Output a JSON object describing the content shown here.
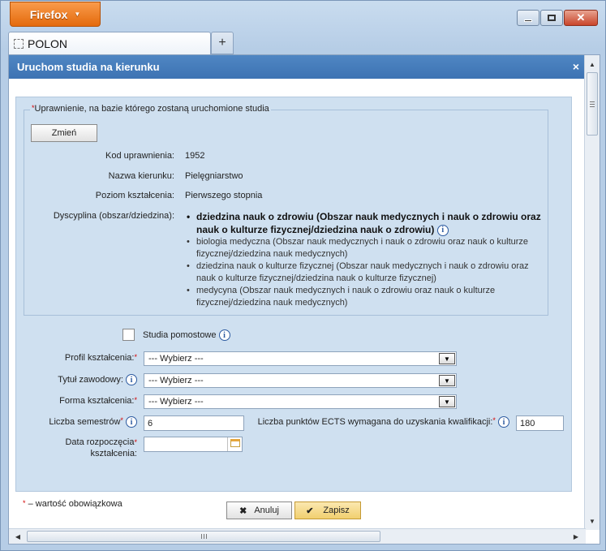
{
  "browser": {
    "app_name": "Firefox",
    "tab_title": "POLON",
    "new_tab_label": "+"
  },
  "dialog": {
    "title": "Uruchom studia na kierunku",
    "close_label": "×"
  },
  "permission": {
    "legend": "Uprawnienie, na bazie którego zostaną uruchomione studia",
    "change_button": "Zmień",
    "rows": [
      {
        "label": "Kod uprawnienia:",
        "value": "1952"
      },
      {
        "label": "Nazwa kierunku:",
        "value": "Pielęgniarstwo"
      },
      {
        "label": "Poziom kształcenia:",
        "value": "Pierwszego stopnia"
      }
    ],
    "discipline_label": "Dyscyplina (obszar/dziedzina):",
    "disciplines": [
      "dziedzina nauk o zdrowiu (Obszar nauk medycznych i nauk o zdrowiu oraz nauk o kulturze fizycznej/dziedzina nauk o zdrowiu)",
      "biologia medyczna (Obszar nauk medycznych i nauk o zdrowiu oraz nauk o kulturze fizycznej/dziedzina nauk medycznych)",
      "dziedzina nauk o kulturze fizycznej (Obszar nauk medycznych i nauk o zdrowiu oraz nauk o kulturze fizycznej/dziedzina nauk o kulturze fizycznej)",
      "medycyna (Obszar nauk medycznych i nauk o zdrowiu oraz nauk o kulturze fizycznej/dziedzina nauk medycznych)"
    ]
  },
  "form": {
    "bridging_label": "Studia pomostowe",
    "bridging_checked": false,
    "profile_label": "Profil kształcenia:",
    "profile_value": "--- Wybierz ---",
    "title_label": "Tytuł zawodowy:",
    "title_value": "--- Wybierz ---",
    "form_label": "Forma kształcenia:",
    "form_value": "--- Wybierz ---",
    "semesters_label": "Liczba semestrów",
    "semesters_value": "6",
    "ects_label": "Liczba punktów ECTS wymagana do uzyskania kwalifikacji:",
    "ects_value": "180",
    "start_date_label_1": "Data rozpoczęcia",
    "start_date_label_2": "kształcenia:",
    "start_date_value": ""
  },
  "required_note": "– wartość obowiązkowa",
  "required_mark": "*",
  "info_mark": "i",
  "actions": {
    "cancel": "Anuluj",
    "save": "Zapisz"
  }
}
